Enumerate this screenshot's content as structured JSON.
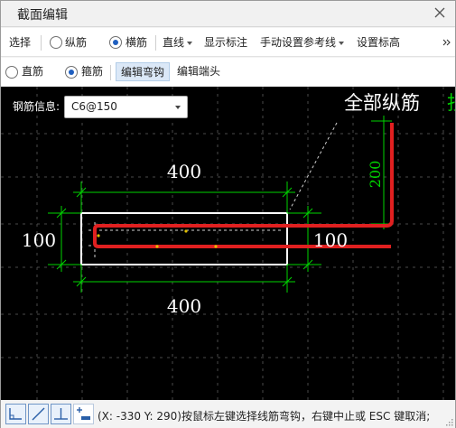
{
  "window": {
    "title": "截面编辑"
  },
  "toolbar1": {
    "select": "选择",
    "longitudinal": "纵筋",
    "transverse": "横筋",
    "straight_line": "直线",
    "show_dimension": "显示标注",
    "manual_ref_line": "手动设置参考线",
    "set_elevation": "设置标高",
    "selected_radio": "横筋"
  },
  "toolbar2": {
    "straight_bar": "直筋",
    "stirrup": "箍筋",
    "edit_bend": "编辑弯钩",
    "edit_end": "编辑端头",
    "selected_radio": "箍筋",
    "active_button": "编辑弯钩"
  },
  "canvas": {
    "rebar_info_label": "钢筋信息:",
    "rebar_info_value": "C6@150",
    "all_long_bars": "全部纵筋",
    "partial_char": "抄",
    "dim_top": "400",
    "dim_bottom": "400",
    "dim_left": "100",
    "dim_right": "100",
    "dim_vertical": "200",
    "colors": {
      "background": "#000000",
      "dimension": "#00ff00",
      "rebar": "#e02020",
      "outline": "#ffffff",
      "text": "#ffffff"
    }
  },
  "statusbar": {
    "message": "(X: -330 Y: 290)按鼠标左键选择线筋弯钩，右键中止或 ESC 键取消;",
    "icons": [
      "orthogonal-icon",
      "diagonal-line-icon",
      "perpendicular-icon",
      "add-dimension-icon"
    ]
  }
}
